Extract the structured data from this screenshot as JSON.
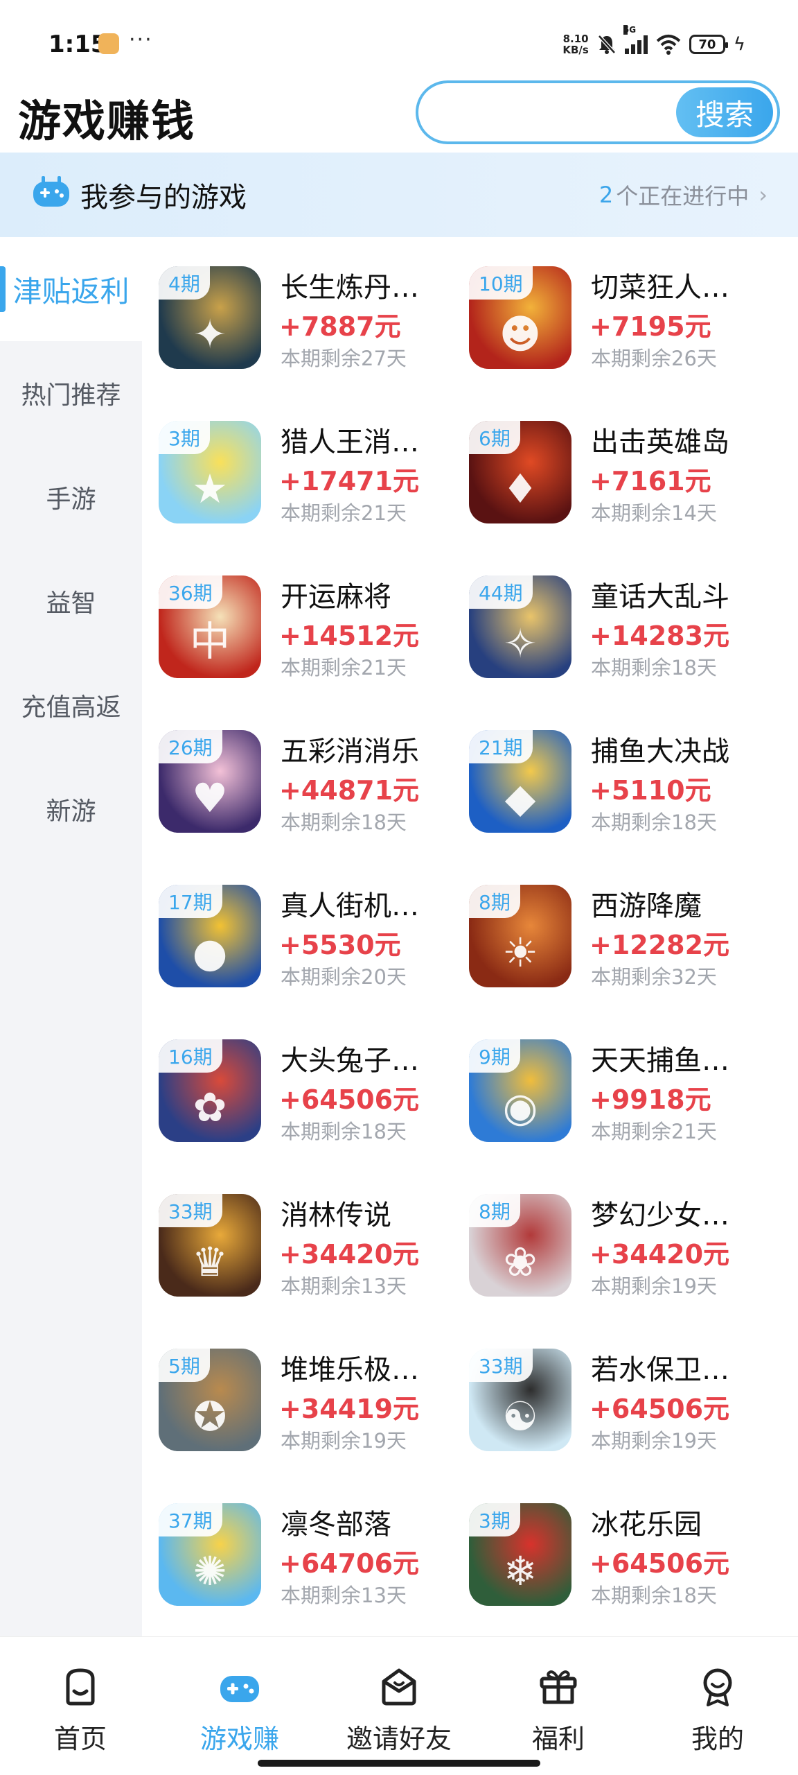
{
  "status_bar": {
    "time": "1:15",
    "overflow": "···",
    "net_speed_value": "8.10",
    "net_speed_unit": "KB/s",
    "signal_label": "5G",
    "battery": "70"
  },
  "header": {
    "title": "游戏赚钱",
    "search": {
      "placeholder": "",
      "value": "",
      "button_label": "搜索"
    }
  },
  "banner": {
    "title": "我参与的游戏",
    "count": "2",
    "status_text": "个正在进行中",
    "chevron": "›"
  },
  "sidebar": {
    "items": [
      {
        "label": "津贴返利",
        "active": true
      },
      {
        "label": "热门推荐",
        "active": false
      },
      {
        "label": "手游",
        "active": false
      },
      {
        "label": "益智",
        "active": false
      },
      {
        "label": "充值高返",
        "active": false
      },
      {
        "label": "新游",
        "active": false
      }
    ]
  },
  "games": [
    {
      "period": "4期",
      "name": "长生炼丹…",
      "reward": "+7887元",
      "remaining": "本期剩余27天",
      "icon": "alchemy-game-icon",
      "colors": [
        "#1f3a4d",
        "#c9a14a"
      ]
    },
    {
      "period": "10期",
      "name": "切菜狂人…",
      "reward": "+7195元",
      "remaining": "本期剩余26天",
      "icon": "chef-game-icon",
      "colors": [
        "#b3241b",
        "#f2b23a"
      ]
    },
    {
      "period": "3期",
      "name": "猎人王消…",
      "reward": "+17471元",
      "remaining": "本期剩余21天",
      "icon": "cat-game-icon",
      "colors": [
        "#8ad3f5",
        "#f9e05a"
      ]
    },
    {
      "period": "6期",
      "name": "出击英雄岛",
      "reward": "+7161元",
      "remaining": "本期剩余14天",
      "icon": "hero-island-game-icon",
      "colors": [
        "#5a1212",
        "#e04a24"
      ]
    },
    {
      "period": "36期",
      "name": "开运麻将",
      "reward": "+14512元",
      "remaining": "本期剩余21天",
      "icon": "mahjong-game-icon",
      "colors": [
        "#c0261c",
        "#f5e1b8"
      ]
    },
    {
      "period": "44期",
      "name": "童话大乱斗",
      "reward": "+14283元",
      "remaining": "本期剩余18天",
      "icon": "fairy-tale-game-icon",
      "colors": [
        "#27407f",
        "#e9c46a"
      ]
    },
    {
      "period": "26期",
      "name": "五彩消消乐",
      "reward": "+44871元",
      "remaining": "本期剩余18天",
      "icon": "match-game-icon",
      "colors": [
        "#3c2a6b",
        "#f3c1d7"
      ]
    },
    {
      "period": "21期",
      "name": "捕鱼大决战",
      "reward": "+5110元",
      "remaining": "本期剩余18天",
      "icon": "fishing-game-icon",
      "colors": [
        "#1d5fc4",
        "#f2c94c"
      ]
    },
    {
      "period": "17期",
      "name": "真人街机…",
      "reward": "+5530元",
      "remaining": "本期剩余20天",
      "icon": "arcade-game-icon",
      "colors": [
        "#1e4ea8",
        "#f2c233"
      ]
    },
    {
      "period": "8期",
      "name": "西游降魔",
      "reward": "+12282元",
      "remaining": "本期剩余32天",
      "icon": "journey-west-game-icon",
      "colors": [
        "#8a2a14",
        "#e7873a"
      ]
    },
    {
      "period": "16期",
      "name": "大头兔子…",
      "reward": "+64506元",
      "remaining": "本期剩余18天",
      "icon": "rabbit-game-icon",
      "colors": [
        "#2b3f86",
        "#d94a3a"
      ]
    },
    {
      "period": "9期",
      "name": "天天捕鱼…",
      "reward": "+9918元",
      "remaining": "本期剩余21天",
      "icon": "daily-fishing-game-icon",
      "colors": [
        "#2e7bd6",
        "#f0bd3c"
      ]
    },
    {
      "period": "33期",
      "name": "消林传说",
      "reward": "+34420元",
      "remaining": "本期剩余13天",
      "icon": "legend-game-icon",
      "colors": [
        "#4a2a1a",
        "#e8a93a"
      ]
    },
    {
      "period": "8期",
      "name": "梦幻少女…",
      "reward": "+34420元",
      "remaining": "本期剩余19天",
      "icon": "dream-girl-game-icon",
      "colors": [
        "#d9d2d6",
        "#b23a3a"
      ]
    },
    {
      "period": "5期",
      "name": "堆堆乐极…",
      "reward": "+34419元",
      "remaining": "本期剩余19天",
      "icon": "sniper-game-icon",
      "colors": [
        "#5f6f78",
        "#b98a4e"
      ]
    },
    {
      "period": "33期",
      "name": "若水保卫…",
      "reward": "+64506元",
      "remaining": "本期剩余19天",
      "icon": "panda-game-icon",
      "colors": [
        "#cfe8f4",
        "#2d2d2d"
      ]
    },
    {
      "period": "37期",
      "name": "凛冬部落",
      "reward": "+64706元",
      "remaining": "本期剩余13天",
      "icon": "blue-cat-game-icon",
      "colors": [
        "#5bb8f0",
        "#f7d24a"
      ]
    },
    {
      "period": "3期",
      "name": "冰花乐园",
      "reward": "+64506元",
      "remaining": "本期剩余18天",
      "icon": "santa-game-icon",
      "colors": [
        "#2f5e3a",
        "#d8322c"
      ]
    }
  ],
  "bottom_nav": {
    "items": [
      {
        "label": "首页",
        "icon": "home-icon",
        "active": false
      },
      {
        "label": "游戏赚",
        "icon": "gamepad-icon",
        "active": true
      },
      {
        "label": "邀请好友",
        "icon": "invite-envelope-icon",
        "active": false
      },
      {
        "label": "福利",
        "icon": "gift-icon",
        "active": false
      },
      {
        "label": "我的",
        "icon": "profile-icon",
        "active": false
      }
    ]
  },
  "colors": {
    "accent": "#3aa6ec",
    "reward": "#e7424a",
    "sidebar_bg": "#f3f4f7"
  }
}
